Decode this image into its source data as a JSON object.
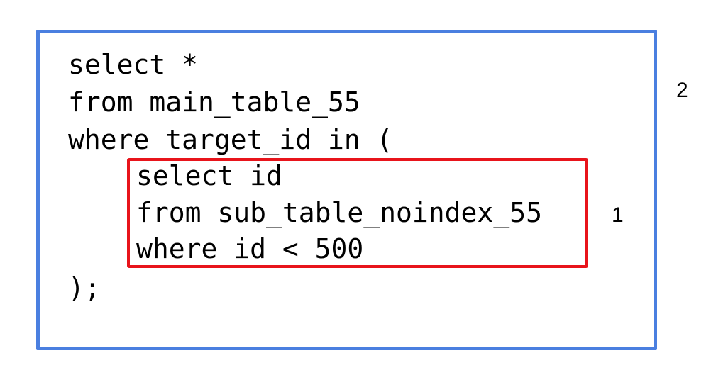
{
  "outer_query": {
    "lines": [
      "select *",
      "from main_table_55",
      "where target_id in ("
    ],
    "closing": ");",
    "label": "2",
    "border_color": "#4A7FE0"
  },
  "subquery": {
    "lines": [
      "select id",
      "from sub_table_noindex_55",
      "where id < 500"
    ],
    "label": "1",
    "border_color": "#E8141B"
  }
}
